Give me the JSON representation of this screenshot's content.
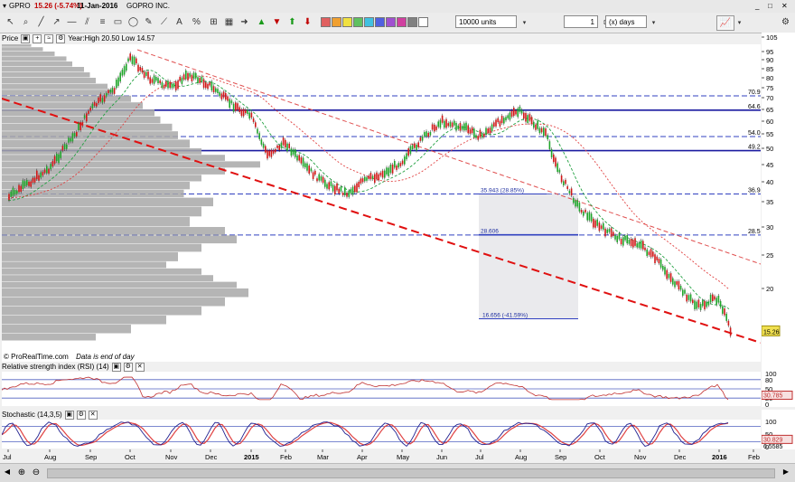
{
  "window": {
    "symbol": "GPRO",
    "last_change": "15.26 (-5.74%)",
    "date": "11-Jan-2016",
    "name": "GOPRO INC."
  },
  "toolbar": {
    "units_value": "10000 units",
    "period_count": "1",
    "period_unit": "(x) days",
    "color_swatches": [
      "#e06060",
      "#f0a030",
      "#f0e040",
      "#60c060",
      "#40c0e0",
      "#5060e0",
      "#a050d0",
      "#d040a0",
      "#808080",
      "#ffffff"
    ]
  },
  "price_panel": {
    "label": "Price",
    "info": "Year:High 20.50 Low 14.57",
    "footer": "© ProRealTime.com",
    "footer_note": "Data is end of day",
    "last_price": "15.26",
    "ticks": [
      "105",
      "95",
      "90",
      "85",
      "80",
      "75",
      "70",
      "65",
      "60",
      "55",
      "50",
      "45",
      "40",
      "35",
      "30",
      "25",
      "20"
    ],
    "level_labels": [
      "70.9",
      "64.69",
      "54.06",
      "49.28",
      "36.94",
      "28.56"
    ],
    "annotations": [
      "35.943 (28.85%)",
      "28.606",
      "16.656 (-41.59%)"
    ]
  },
  "rsi_panel": {
    "label": "Relative strength index (RSI) (14)",
    "ticks": [
      "100",
      "80",
      "50",
      "20",
      "0"
    ],
    "value": "30.785"
  },
  "stoch_panel": {
    "label": "Stochastic (14,3,5)",
    "ticks": [
      "100",
      "50",
      "0"
    ],
    "value_k": "30.829",
    "value_d": "6.5585"
  },
  "x_axis": {
    "labels": [
      "Jul",
      "Aug",
      "Sep",
      "Oct",
      "Nov",
      "Dec",
      "2015",
      "Feb",
      "Mar",
      "Apr",
      "May",
      "Jun",
      "Jul",
      "Aug",
      "Sep",
      "Oct",
      "Nov",
      "Dec",
      "2016",
      "Feb"
    ]
  },
  "chart_data": {
    "type": "candlestick",
    "price_levels": [
      70.9,
      64.69,
      54.06,
      49.28,
      36.94,
      28.56
    ],
    "close_path": [
      {
        "x": "2014-07",
        "y": 36
      },
      {
        "x": "2014-08",
        "y": 44
      },
      {
        "x": "2014-08-20",
        "y": 55
      },
      {
        "x": "2014-09",
        "y": 65
      },
      {
        "x": "2014-09-20",
        "y": 75
      },
      {
        "x": "2014-10",
        "y": 92
      },
      {
        "x": "2014-10-15",
        "y": 80
      },
      {
        "x": "2014-11",
        "y": 75
      },
      {
        "x": "2014-11-15",
        "y": 82
      },
      {
        "x": "2014-12",
        "y": 76
      },
      {
        "x": "2014-12-15",
        "y": 68
      },
      {
        "x": "2015-01",
        "y": 62
      },
      {
        "x": "2015-01-15",
        "y": 48
      },
      {
        "x": "2015-02",
        "y": 52
      },
      {
        "x": "2015-02-15",
        "y": 45
      },
      {
        "x": "2015-03",
        "y": 40
      },
      {
        "x": "2015-03-20",
        "y": 37
      },
      {
        "x": "2015-04",
        "y": 40
      },
      {
        "x": "2015-04-20",
        "y": 43
      },
      {
        "x": "2015-05",
        "y": 46
      },
      {
        "x": "2015-05-20",
        "y": 55
      },
      {
        "x": "2015-06",
        "y": 60
      },
      {
        "x": "2015-06-20",
        "y": 57
      },
      {
        "x": "2015-07",
        "y": 54
      },
      {
        "x": "2015-07-20",
        "y": 62
      },
      {
        "x": "2015-08",
        "y": 64
      },
      {
        "x": "2015-08-20",
        "y": 55
      },
      {
        "x": "2015-09",
        "y": 42
      },
      {
        "x": "2015-09-15",
        "y": 34
      },
      {
        "x": "2015-10",
        "y": 30
      },
      {
        "x": "2015-10-15",
        "y": 28
      },
      {
        "x": "2015-11",
        "y": 27
      },
      {
        "x": "2015-11-15",
        "y": 24
      },
      {
        "x": "2015-12",
        "y": 20
      },
      {
        "x": "2015-12-15",
        "y": 18
      },
      {
        "x": "2016-01",
        "y": 19
      },
      {
        "x": "2016-01-11",
        "y": 15.26
      }
    ]
  }
}
